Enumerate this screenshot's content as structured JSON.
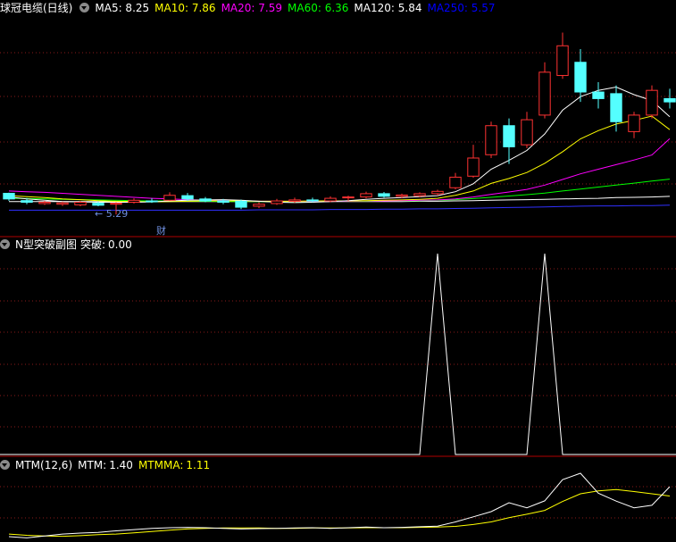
{
  "panel_main": {
    "title": "球冠电缆(日线)",
    "ma_labels": [
      {
        "label": "MA5:",
        "value": "8.25",
        "color": "#ffffff"
      },
      {
        "label": "MA10:",
        "value": "7.86",
        "color": "#ffff00"
      },
      {
        "label": "MA20:",
        "value": "7.59",
        "color": "#ff00ff"
      },
      {
        "label": "MA60:",
        "value": "6.36",
        "color": "#00ff00"
      },
      {
        "label": "MA120:",
        "value": "5.84",
        "color": "#ffffff"
      },
      {
        "label": "MA250:",
        "value": "5.57",
        "color": "#0000ff"
      }
    ],
    "low_annotation": "← 5.29",
    "event_marker": "财"
  },
  "panel_n": {
    "title": "N型突破副图",
    "value_label": "突破:",
    "value": "0.00"
  },
  "panel_mtm": {
    "title": "MTM(12,6)",
    "mtm_label": "MTM:",
    "mtm_value": "1.40",
    "mtmma_label": "MTMMA:",
    "mtmma_value": "1.11"
  },
  "colors": {
    "up": "#ff3232",
    "down": "#54ffff",
    "divider": "#b00000",
    "grid": "#8a1a1a",
    "ma5": "#ffffff",
    "ma10": "#ffff00",
    "ma20": "#ff00ff",
    "ma60": "#00ff00",
    "ma120": "#ffffff",
    "ma250": "#3030ff",
    "signal": "#ffffff",
    "mtm": "#ffffff",
    "mtmma": "#ffff00"
  },
  "chart_data": [
    {
      "type": "candlestick",
      "title": "球冠电缆(日线)",
      "ylim": [
        4.7,
        11.3
      ],
      "candles": [
        {
          "o": 5.93,
          "h": 5.95,
          "l": 5.7,
          "c": 5.76
        },
        {
          "o": 5.71,
          "h": 5.79,
          "l": 5.6,
          "c": 5.66
        },
        {
          "o": 5.62,
          "h": 5.7,
          "l": 5.58,
          "c": 5.66
        },
        {
          "o": 5.6,
          "h": 5.68,
          "l": 5.55,
          "c": 5.64
        },
        {
          "o": 5.58,
          "h": 5.7,
          "l": 5.54,
          "c": 5.66
        },
        {
          "o": 5.63,
          "h": 5.68,
          "l": 5.54,
          "c": 5.57
        },
        {
          "o": 5.6,
          "h": 5.66,
          "l": 5.29,
          "c": 5.63
        },
        {
          "o": 5.66,
          "h": 5.78,
          "l": 5.62,
          "c": 5.72
        },
        {
          "o": 5.7,
          "h": 5.78,
          "l": 5.64,
          "c": 5.69
        },
        {
          "o": 5.72,
          "h": 5.96,
          "l": 5.7,
          "c": 5.87
        },
        {
          "o": 5.86,
          "h": 5.94,
          "l": 5.7,
          "c": 5.76
        },
        {
          "o": 5.76,
          "h": 5.82,
          "l": 5.66,
          "c": 5.7
        },
        {
          "o": 5.7,
          "h": 5.76,
          "l": 5.6,
          "c": 5.66
        },
        {
          "o": 5.69,
          "h": 5.74,
          "l": 5.45,
          "c": 5.51
        },
        {
          "o": 5.54,
          "h": 5.66,
          "l": 5.48,
          "c": 5.6
        },
        {
          "o": 5.62,
          "h": 5.76,
          "l": 5.58,
          "c": 5.7
        },
        {
          "o": 5.69,
          "h": 5.8,
          "l": 5.64,
          "c": 5.73
        },
        {
          "o": 5.73,
          "h": 5.8,
          "l": 5.66,
          "c": 5.7
        },
        {
          "o": 5.7,
          "h": 5.84,
          "l": 5.66,
          "c": 5.78
        },
        {
          "o": 5.8,
          "h": 5.86,
          "l": 5.7,
          "c": 5.82
        },
        {
          "o": 5.82,
          "h": 5.98,
          "l": 5.78,
          "c": 5.92
        },
        {
          "o": 5.92,
          "h": 5.97,
          "l": 5.8,
          "c": 5.84
        },
        {
          "o": 5.84,
          "h": 5.92,
          "l": 5.78,
          "c": 5.88
        },
        {
          "o": 5.86,
          "h": 5.96,
          "l": 5.82,
          "c": 5.92
        },
        {
          "o": 5.92,
          "h": 6.04,
          "l": 5.86,
          "c": 5.99
        },
        {
          "o": 6.1,
          "h": 6.55,
          "l": 6.05,
          "c": 6.42
        },
        {
          "o": 6.45,
          "h": 7.4,
          "l": 6.4,
          "c": 7.0
        },
        {
          "o": 7.1,
          "h": 8.1,
          "l": 7.0,
          "c": 7.98
        },
        {
          "o": 7.98,
          "h": 8.2,
          "l": 6.82,
          "c": 7.34
        },
        {
          "o": 7.4,
          "h": 8.4,
          "l": 7.3,
          "c": 8.16
        },
        {
          "o": 8.3,
          "h": 9.9,
          "l": 8.2,
          "c": 9.6
        },
        {
          "o": 9.5,
          "h": 10.8,
          "l": 9.4,
          "c": 10.4
        },
        {
          "o": 9.9,
          "h": 10.3,
          "l": 8.7,
          "c": 9.0
        },
        {
          "o": 9.0,
          "h": 9.3,
          "l": 8.5,
          "c": 8.8
        },
        {
          "o": 8.95,
          "h": 9.2,
          "l": 7.8,
          "c": 8.1
        },
        {
          "o": 7.8,
          "h": 8.4,
          "l": 7.6,
          "c": 8.3
        },
        {
          "o": 8.3,
          "h": 9.2,
          "l": 8.2,
          "c": 9.05
        },
        {
          "o": 8.8,
          "h": 9.1,
          "l": 8.5,
          "c": 8.7
        }
      ],
      "ma": {
        "ma5": [
          5.82,
          5.76,
          5.72,
          5.68,
          5.67,
          5.66,
          5.66,
          5.66,
          5.67,
          5.7,
          5.72,
          5.73,
          5.74,
          5.72,
          5.69,
          5.66,
          5.65,
          5.66,
          5.68,
          5.71,
          5.75,
          5.78,
          5.8,
          5.83,
          5.86,
          5.98,
          6.22,
          6.66,
          6.93,
          7.23,
          7.73,
          8.45,
          8.86,
          9.05,
          9.15,
          8.92,
          8.74,
          8.25
        ],
        "ma10": [
          5.86,
          5.83,
          5.8,
          5.76,
          5.74,
          5.71,
          5.69,
          5.68,
          5.67,
          5.68,
          5.69,
          5.7,
          5.7,
          5.7,
          5.69,
          5.69,
          5.69,
          5.7,
          5.7,
          5.7,
          5.71,
          5.72,
          5.73,
          5.75,
          5.78,
          5.87,
          6.0,
          6.23,
          6.38,
          6.56,
          6.84,
          7.19,
          7.58,
          7.83,
          8.03,
          8.14,
          8.27,
          7.86
        ],
        "ma20": [
          6.0,
          5.98,
          5.96,
          5.93,
          5.9,
          5.87,
          5.84,
          5.81,
          5.78,
          5.76,
          5.74,
          5.72,
          5.71,
          5.7,
          5.69,
          5.69,
          5.69,
          5.69,
          5.69,
          5.69,
          5.7,
          5.7,
          5.71,
          5.72,
          5.73,
          5.76,
          5.82,
          5.9,
          5.97,
          6.05,
          6.18,
          6.35,
          6.52,
          6.66,
          6.8,
          6.94,
          7.09,
          7.59
        ],
        "ma60": [
          5.78,
          5.77,
          5.76,
          5.75,
          5.74,
          5.73,
          5.72,
          5.71,
          5.7,
          5.7,
          5.69,
          5.69,
          5.68,
          5.68,
          5.68,
          5.68,
          5.68,
          5.68,
          5.69,
          5.69,
          5.69,
          5.7,
          5.7,
          5.71,
          5.72,
          5.74,
          5.77,
          5.81,
          5.85,
          5.89,
          5.94,
          6.0,
          6.06,
          6.12,
          6.18,
          6.24,
          6.3,
          6.36
        ],
        "ma120": [
          5.68,
          5.68,
          5.68,
          5.68,
          5.68,
          5.68,
          5.68,
          5.68,
          5.68,
          5.68,
          5.68,
          5.68,
          5.68,
          5.68,
          5.68,
          5.68,
          5.68,
          5.68,
          5.68,
          5.68,
          5.68,
          5.68,
          5.68,
          5.69,
          5.69,
          5.7,
          5.71,
          5.72,
          5.73,
          5.74,
          5.75,
          5.76,
          5.77,
          5.78,
          5.8,
          5.81,
          5.82,
          5.84
        ],
        "ma250": [
          5.42,
          5.42,
          5.42,
          5.42,
          5.42,
          5.42,
          5.42,
          5.42,
          5.42,
          5.42,
          5.42,
          5.42,
          5.42,
          5.42,
          5.43,
          5.43,
          5.43,
          5.43,
          5.44,
          5.44,
          5.44,
          5.45,
          5.45,
          5.46,
          5.46,
          5.47,
          5.48,
          5.49,
          5.5,
          5.51,
          5.52,
          5.53,
          5.54,
          5.55,
          5.55,
          5.56,
          5.56,
          5.57
        ]
      }
    },
    {
      "type": "line",
      "title": "N型突破副图",
      "series": [
        {
          "name": "突破",
          "values": [
            0,
            0,
            0,
            0,
            0,
            0,
            0,
            0,
            0,
            0,
            0,
            0,
            0,
            0,
            0,
            0,
            0,
            0,
            0,
            0,
            0,
            0,
            0,
            0,
            1,
            0,
            0,
            0,
            0,
            0,
            1,
            0,
            0,
            0,
            0,
            0,
            0,
            0
          ]
        }
      ],
      "ylim": [
        0,
        1
      ]
    },
    {
      "type": "line",
      "title": "MTM(12,6)",
      "ylim": [
        -0.3,
        2.1
      ],
      "series": [
        {
          "name": "MTM",
          "values": [
            -0.16,
            -0.2,
            -0.14,
            -0.08,
            -0.05,
            -0.03,
            0.02,
            0.06,
            0.1,
            0.12,
            0.13,
            0.12,
            0.1,
            0.08,
            0.09,
            0.1,
            0.11,
            0.12,
            0.1,
            0.12,
            0.14,
            0.12,
            0.13,
            0.15,
            0.17,
            0.3,
            0.46,
            0.62,
            0.9,
            0.74,
            0.96,
            1.62,
            1.82,
            1.2,
            0.95,
            0.74,
            0.82,
            1.4
          ]
        },
        {
          "name": "MTMMA",
          "values": [
            -0.08,
            -0.12,
            -0.14,
            -0.15,
            -0.13,
            -0.1,
            -0.08,
            -0.04,
            0.0,
            0.04,
            0.08,
            0.1,
            0.11,
            0.11,
            0.11,
            0.1,
            0.1,
            0.11,
            0.11,
            0.11,
            0.12,
            0.12,
            0.12,
            0.13,
            0.14,
            0.16,
            0.22,
            0.3,
            0.43,
            0.54,
            0.66,
            0.94,
            1.18,
            1.27,
            1.31,
            1.25,
            1.18,
            1.11
          ]
        }
      ]
    }
  ]
}
